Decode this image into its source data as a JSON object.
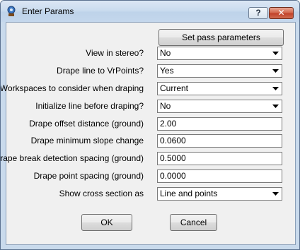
{
  "window": {
    "title": "Enter Params",
    "help_label": "?",
    "close_label": "✕"
  },
  "set_pass_button": "Set pass parameters",
  "params": [
    {
      "label": "View in stereo?",
      "value": "No",
      "kind": "combo"
    },
    {
      "label": "Drape line to VrPoints?",
      "value": "Yes",
      "kind": "combo"
    },
    {
      "label": "Workspaces to consider when draping",
      "value": "Current",
      "kind": "combo"
    },
    {
      "label": "Initialize line before draping?",
      "value": "No",
      "kind": "combo"
    },
    {
      "label": "Drape offset distance (ground)",
      "value": "2.00",
      "kind": "field"
    },
    {
      "label": "Drape minimum slope change",
      "value": "0.0600",
      "kind": "field"
    },
    {
      "label": "Drape break detection spacing (ground)",
      "value": "0.5000",
      "kind": "field"
    },
    {
      "label": "Drape point spacing (ground)",
      "value": "0.0000",
      "kind": "field"
    },
    {
      "label": "Show cross section as",
      "value": "Line and points",
      "kind": "combo"
    }
  ],
  "buttons": {
    "ok": "OK",
    "cancel": "Cancel"
  },
  "colors": {
    "title_bar": "#c9daec",
    "close_button": "#c2432a",
    "dialog_face": "#f0f0f0"
  }
}
